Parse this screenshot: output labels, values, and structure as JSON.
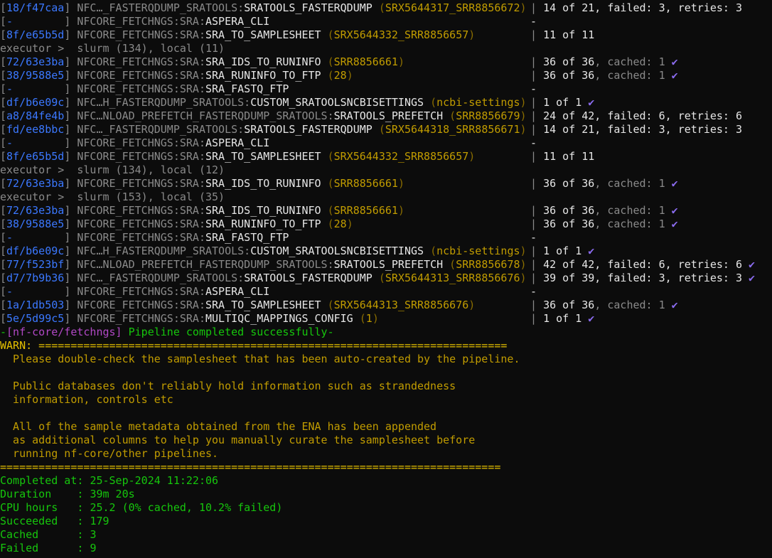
{
  "process_lines": [
    {
      "kind": "proc",
      "hash": "18/f47caa",
      "prefix": "NFC…_FASTERQDUMP_SRATOOLS:",
      "name": "SRATOOLS_FASTERQDUMP",
      "tag": "SRX5644317_SRR8856672",
      "status": "14 of 21, failed: 3, retries: 3",
      "cached": "",
      "check": false
    },
    {
      "kind": "proc",
      "hash": "-        ",
      "prefix": "NFCORE_FETCHNGS:SRA:",
      "name": "ASPERA_CLI",
      "tag": "",
      "status": "-",
      "cached": "",
      "check": false
    },
    {
      "kind": "proc",
      "hash": "8f/e65b5d",
      "prefix": "NFCORE_FETCHNGS:SRA:",
      "name": "SRA_TO_SAMPLESHEET",
      "tag": "SRX5644332_SRR8856657",
      "status": "11 of 11",
      "cached": "",
      "check": false
    },
    {
      "kind": "exec",
      "text": "executor >  slurm (134), local (11)"
    },
    {
      "kind": "proc",
      "hash": "72/63e3ba",
      "prefix": "NFCORE_FETCHNGS:SRA:",
      "name": "SRA_IDS_TO_RUNINFO",
      "tag": "SRR8856661",
      "status": "36 of 36",
      "cached": ", cached: 1",
      "check": true
    },
    {
      "kind": "proc",
      "hash": "38/9588e5",
      "prefix": "NFCORE_FETCHNGS:SRA:",
      "name": "SRA_RUNINFO_TO_FTP",
      "tag": "28",
      "status": "36 of 36",
      "cached": ", cached: 1",
      "check": true
    },
    {
      "kind": "proc",
      "hash": "-        ",
      "prefix": "NFCORE_FETCHNGS:SRA:",
      "name": "SRA_FASTQ_FTP",
      "tag": "",
      "status": "-",
      "cached": "",
      "check": false
    },
    {
      "kind": "proc",
      "hash": "df/b6e09c",
      "prefix": "NFC…H_FASTERQDUMP_SRATOOLS:",
      "name": "CUSTOM_SRATOOLSNCBISETTINGS",
      "tag": "ncbi-settings",
      "status": "1 of 1",
      "cached": "",
      "check": true
    },
    {
      "kind": "proc",
      "hash": "a8/84fe4b",
      "prefix": "NFC…NLOAD_PREFETCH_FASTERQDUMP_SRATOOLS:",
      "name": "SRATOOLS_PREFETCH",
      "tag": "SRR8856679",
      "status": "24 of 42, failed: 6, retries: 6",
      "cached": "",
      "check": false
    },
    {
      "kind": "proc",
      "hash": "fd/ee8bbc",
      "prefix": "NFC…_FASTERQDUMP_SRATOOLS:",
      "name": "SRATOOLS_FASTERQDUMP",
      "tag": "SRX5644318_SRR8856671",
      "status": "14 of 21, failed: 3, retries: 3",
      "cached": "",
      "check": false
    },
    {
      "kind": "proc",
      "hash": "-        ",
      "prefix": "NFCORE_FETCHNGS:SRA:",
      "name": "ASPERA_CLI",
      "tag": "",
      "status": "-",
      "cached": "",
      "check": false
    },
    {
      "kind": "proc",
      "hash": "8f/e65b5d",
      "prefix": "NFCORE_FETCHNGS:SRA:",
      "name": "SRA_TO_SAMPLESHEET",
      "tag": "SRX5644332_SRR8856657",
      "status": "11 of 11",
      "cached": "",
      "check": false
    },
    {
      "kind": "exec",
      "text": "executor >  slurm (134), local (12)"
    },
    {
      "kind": "proc",
      "hash": "72/63e3ba",
      "prefix": "NFCORE_FETCHNGS:SRA:",
      "name": "SRA_IDS_TO_RUNINFO",
      "tag": "SRR8856661",
      "status": "36 of 36",
      "cached": ", cached: 1",
      "check": true
    },
    {
      "kind": "exec",
      "text": "executor >  slurm (153), local (35)"
    },
    {
      "kind": "proc",
      "hash": "72/63e3ba",
      "prefix": "NFCORE_FETCHNGS:SRA:",
      "name": "SRA_IDS_TO_RUNINFO",
      "tag": "SRR8856661",
      "status": "36 of 36",
      "cached": ", cached: 1",
      "check": true
    },
    {
      "kind": "proc",
      "hash": "38/9588e5",
      "prefix": "NFCORE_FETCHNGS:SRA:",
      "name": "SRA_RUNINFO_TO_FTP",
      "tag": "28",
      "status": "36 of 36",
      "cached": ", cached: 1",
      "check": true
    },
    {
      "kind": "proc",
      "hash": "-        ",
      "prefix": "NFCORE_FETCHNGS:SRA:",
      "name": "SRA_FASTQ_FTP",
      "tag": "",
      "status": "-",
      "cached": "",
      "check": false
    },
    {
      "kind": "proc",
      "hash": "df/b6e09c",
      "prefix": "NFC…H_FASTERQDUMP_SRATOOLS:",
      "name": "CUSTOM_SRATOOLSNCBISETTINGS",
      "tag": "ncbi-settings",
      "status": "1 of 1",
      "cached": "",
      "check": true
    },
    {
      "kind": "proc",
      "hash": "77/f523bf",
      "prefix": "NFC…NLOAD_PREFETCH_FASTERQDUMP_SRATOOLS:",
      "name": "SRATOOLS_PREFETCH",
      "tag": "SRR8856678",
      "status": "42 of 42, failed: 6, retries: 6",
      "cached": "",
      "check": true
    },
    {
      "kind": "proc",
      "hash": "d7/7b9b36",
      "prefix": "NFC…_FASTERQDUMP_SRATOOLS:",
      "name": "SRATOOLS_FASTERQDUMP",
      "tag": "SRX5644313_SRR8856676",
      "status": "39 of 39, failed: 3, retries: 3",
      "cached": "",
      "check": true
    },
    {
      "kind": "proc",
      "hash": "-        ",
      "prefix": "NFCORE_FETCHNGS:SRA:",
      "name": "ASPERA_CLI",
      "tag": "",
      "status": "-",
      "cached": "",
      "check": false
    },
    {
      "kind": "proc",
      "hash": "1a/1db503",
      "prefix": "NFCORE_FETCHNGS:SRA:",
      "name": "SRA_TO_SAMPLESHEET",
      "tag": "SRX5644313_SRR8856676",
      "status": "36 of 36",
      "cached": ", cached: 1",
      "check": true
    },
    {
      "kind": "proc",
      "hash": "5e/5d99c5",
      "prefix": "NFCORE_FETCHNGS:SRA:",
      "name": "MULTIQC_MAPPINGS_CONFIG",
      "tag": "1",
      "status": "1 of 1",
      "cached": "",
      "check": true
    }
  ],
  "completion": {
    "dash_left": "-",
    "pipeline_name": "[nf-core/fetchngs]",
    "message": " Pipeline completed successfully",
    "dash_right": "-"
  },
  "warning": {
    "label": "WARN:",
    "separator_head": " =========================================================================",
    "lines": [
      "  Please double-check the samplesheet that has been auto-created by the pipeline.",
      "",
      "  Public databases don't reliably hold information such as strandedness",
      "  information, controls etc",
      "",
      "  All of the sample metadata obtained from the ENA has been appended",
      "  as additional columns to help you manually curate the samplesheet before",
      "  running nf-core/other pipelines."
    ],
    "separator_foot": "=============================================================================="
  },
  "summary": [
    {
      "label": "Completed at",
      "value": "25-Sep-2024 11:22:06"
    },
    {
      "label": "Duration    ",
      "value": "39m 20s"
    },
    {
      "label": "CPU hours   ",
      "value": "25.2 (0% cached, 10.2% failed)"
    },
    {
      "label": "Succeeded   ",
      "value": "179"
    },
    {
      "label": "Cached      ",
      "value": "3"
    },
    {
      "label": "Failed      ",
      "value": "9"
    }
  ],
  "icons": {
    "check": "checkmark-icon"
  },
  "colors": {
    "background": "#0c0c0c",
    "hash": "#3b78ff",
    "tag": "#c19c00",
    "success": "#16c60c",
    "check": "#8b6cf0",
    "pipeline": "#b148c6"
  }
}
